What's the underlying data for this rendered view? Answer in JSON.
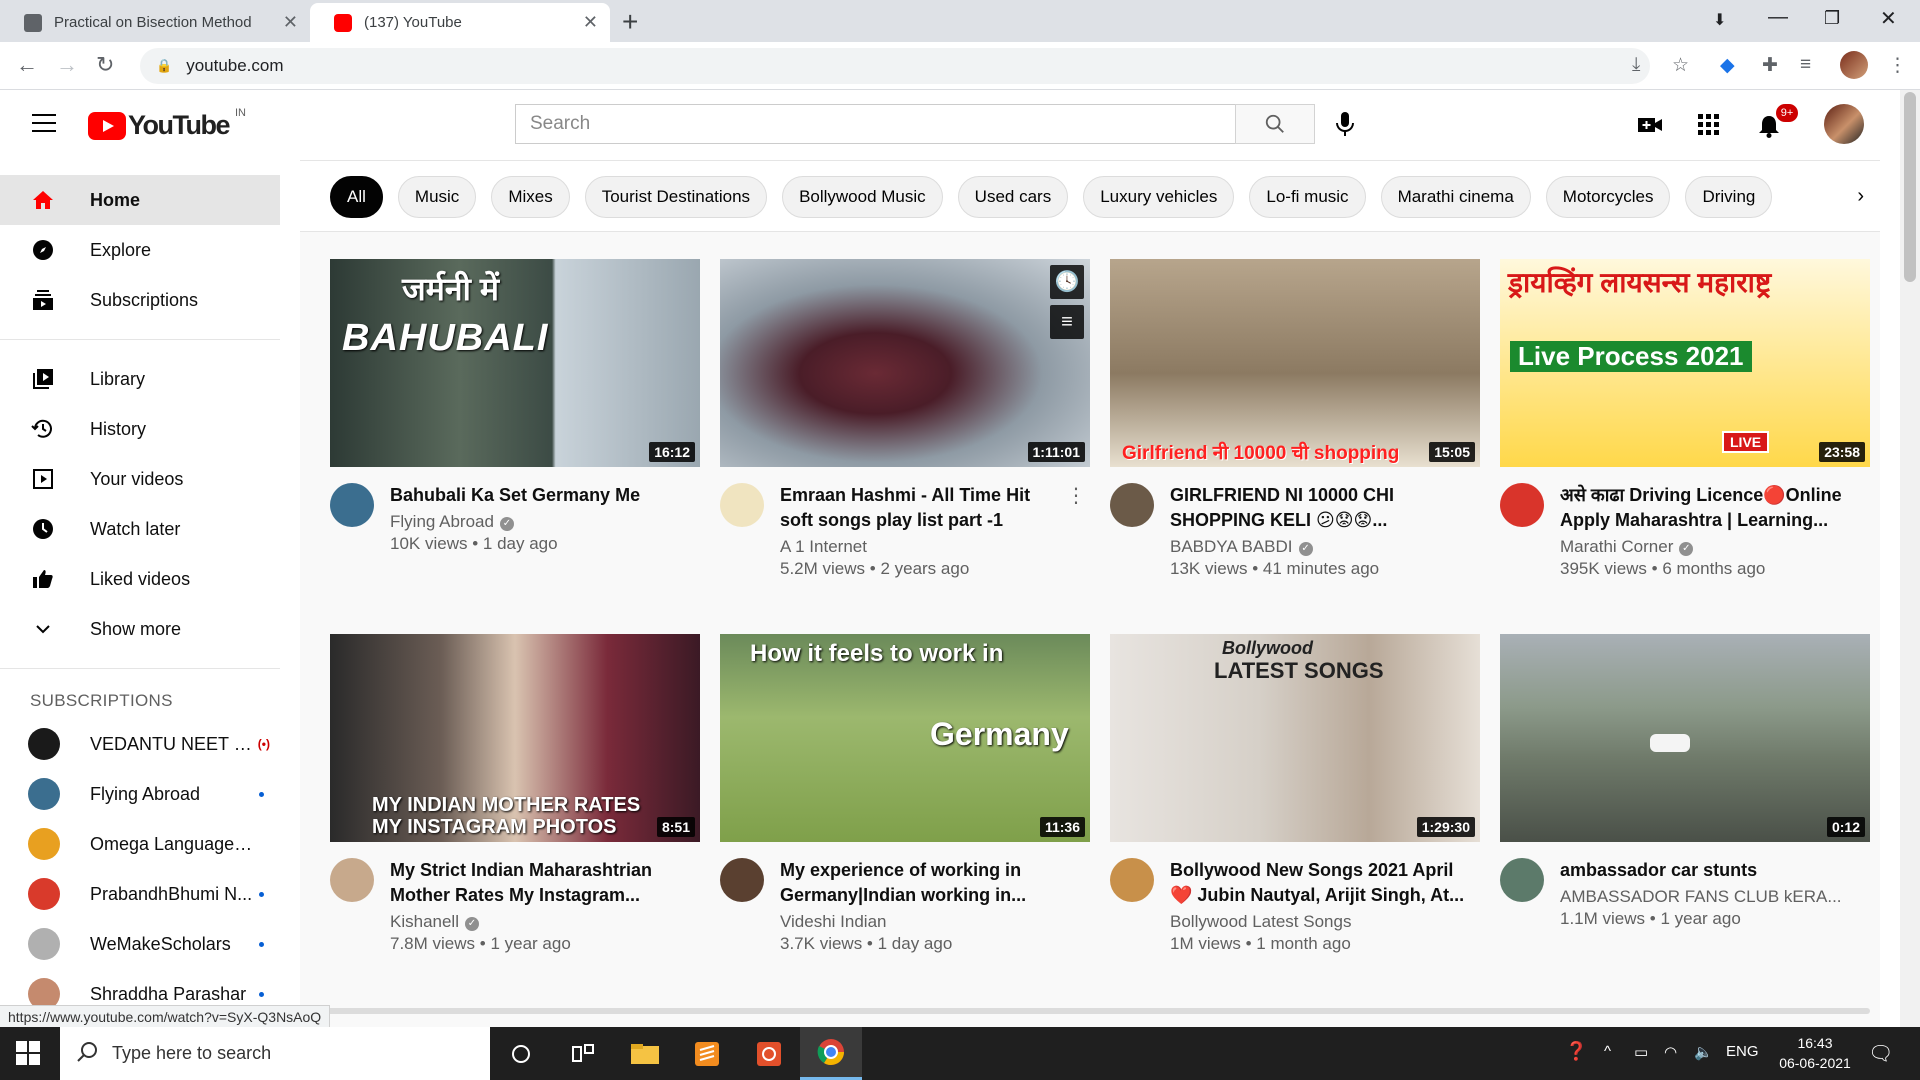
{
  "browser": {
    "tabs": [
      {
        "title": "Practical on Bisection Method",
        "active": false
      },
      {
        "title": "(137) YouTube",
        "active": true
      }
    ],
    "url": "youtube.com",
    "status_url": "https://www.youtube.com/watch?v=SyX-Q3NsAoQ"
  },
  "header": {
    "logo_text": "YouTube",
    "country_code": "IN",
    "search_placeholder": "Search",
    "notifications_badge": "9+"
  },
  "sidebar": {
    "main": [
      {
        "label": "Home",
        "icon": "home-icon",
        "active": true
      },
      {
        "label": "Explore",
        "icon": "compass-icon"
      },
      {
        "label": "Subscriptions",
        "icon": "subscriptions-icon"
      }
    ],
    "library": [
      {
        "label": "Library",
        "icon": "library-icon"
      },
      {
        "label": "History",
        "icon": "history-icon"
      },
      {
        "label": "Your videos",
        "icon": "your-videos-icon"
      },
      {
        "label": "Watch later",
        "icon": "clock-icon"
      },
      {
        "label": "Liked videos",
        "icon": "thumbs-up-icon"
      },
      {
        "label": "Show more",
        "icon": "chevron-down-icon"
      }
    ],
    "subscriptions_heading": "SUBSCRIPTIONS",
    "subscriptions": [
      {
        "name": "VEDANTU NEET M...",
        "badge": "live",
        "avatar_color": "#1a1a1a"
      },
      {
        "name": "Flying Abroad",
        "badge": "dot",
        "avatar_color": "#3b6e8f"
      },
      {
        "name": "Omega Language Ac...",
        "badge": "",
        "avatar_color": "#e8a020"
      },
      {
        "name": "PrabandhBhumi N...",
        "badge": "dot",
        "avatar_color": "#d93a2b"
      },
      {
        "name": "WeMakeScholars",
        "badge": "dot",
        "avatar_color": "#b0b0b0"
      },
      {
        "name": "Shraddha Parashar",
        "badge": "dot",
        "avatar_color": "#c58a6e"
      }
    ]
  },
  "chips": [
    "All",
    "Music",
    "Mixes",
    "Tourist Destinations",
    "Bollywood Music",
    "Used cars",
    "Luxury vehicles",
    "Lo-fi music",
    "Marathi cinema",
    "Motorcycles",
    "Driving"
  ],
  "videos": [
    {
      "title": "Bahubali Ka Set Germany Me",
      "channel": "Flying Abroad",
      "verified": true,
      "views": "10K views",
      "age": "1 day ago",
      "duration": "16:12",
      "thumb_text": "जर्मनी में",
      "thumb_text2": "BAHUBALI",
      "bg": "linear-gradient(90deg,#2d3a35 0%,#5a6a5c 35%,#3c4b45 60%,#c9d3da 61%,#9aa7b0 100%)",
      "avatar_color": "#3b6e8f"
    },
    {
      "title": "Emraan Hashmi - All Time Hit soft songs play list part -1",
      "channel": "A 1 Internet",
      "verified": false,
      "views": "5.2M views",
      "age": "2 years ago",
      "duration": "1:11:01",
      "thumb_text": "",
      "thumb_text2": "",
      "bg": "radial-gradient(ellipse at 42% 55%,#6a2a35 0%,#4a1d28 25%,#8e9aa4 55%,#cfd6dc 100%)",
      "avatar_color": "#f0e4c0"
    },
    {
      "title": "GIRLFRIEND NI 10000 CHI SHOPPING KELI 😕😟😟...",
      "channel": "BABDYA BABDI",
      "verified": true,
      "views": "13K views",
      "age": "41 minutes ago",
      "duration": "15:05",
      "thumb_text": "Girlfriend नी 10000 ची shopping",
      "thumb_text2": "",
      "bg": "linear-gradient(180deg,#b7a58c 0%,#8c7a62 55%,#e8e0d0 100%)",
      "avatar_color": "#6b5a48"
    },
    {
      "title": "असे काढा Driving Licence🔴Online Apply Maharashtra | Learning...",
      "channel": "Marathi Corner",
      "verified": true,
      "views": "395K views",
      "age": "6 months ago",
      "duration": "23:58",
      "thumb_text": "ड्रायव्हिंग लायसन्स महाराष्ट्र",
      "thumb_text2": "Live Process 2021",
      "bg": "linear-gradient(180deg,#fff8dc 0%,#ffd84a 100%)",
      "avatar_color": "#d9342b"
    },
    {
      "title": "My Strict Indian Maharashtrian Mother Rates My Instagram...",
      "channel": "Kishanell",
      "verified": true,
      "views": "7.8M views",
      "age": "1 year ago",
      "duration": "8:51",
      "thumb_text": "MY INDIAN MOTHER RATES",
      "thumb_text2": "MY INSTAGRAM PHOTOS",
      "bg": "linear-gradient(90deg,#2a2a2a 0%,#6b5d55 30%,#d9c3b0 50%,#7a2a3a 75%,#3b1a25 100%)",
      "avatar_color": "#c7a98c"
    },
    {
      "title": "My experience of working in Germany|Indian working in...",
      "channel": "Videshi Indian",
      "verified": false,
      "views": "3.7K views",
      "age": "1 day ago",
      "duration": "11:36",
      "thumb_text": "How it feels to work in",
      "thumb_text2": "Germany",
      "bg": "linear-gradient(180deg,#6b8a5a 0%,#9cb86e 40%,#7fa04a 100%)",
      "avatar_color": "#5a4030"
    },
    {
      "title": "Bollywood New Songs 2021 April ❤️ Jubin Nautyal, Arijit Singh, At...",
      "channel": "Bollywood Latest Songs",
      "verified": false,
      "views": "1M views",
      "age": "1 month ago",
      "duration": "1:29:30",
      "thumb_text": "Bollywood",
      "thumb_text2": "LATEST SONGS",
      "bg": "linear-gradient(90deg,#e8e4e0 0%,#d6d0c8 40%,#b8a898 70%,#e6dfd6 100%)",
      "avatar_color": "#c8904a"
    },
    {
      "title": "ambassador car stunts",
      "channel": "AMBASSADOR FANS CLUB kERA...",
      "verified": false,
      "views": "1.1M views",
      "age": "1 year ago",
      "duration": "0:12",
      "thumb_text": "",
      "thumb_text2": "",
      "bg": "linear-gradient(180deg,#a9b0b6 0%,#8c9a8a 35%,#6f7a6a 60%,#4a5048 100%)",
      "avatar_color": "#5c7a6a"
    }
  ],
  "taskbar": {
    "search_placeholder": "Type here to search",
    "language": "ENG",
    "time": "16:43",
    "date": "06-06-2021"
  }
}
